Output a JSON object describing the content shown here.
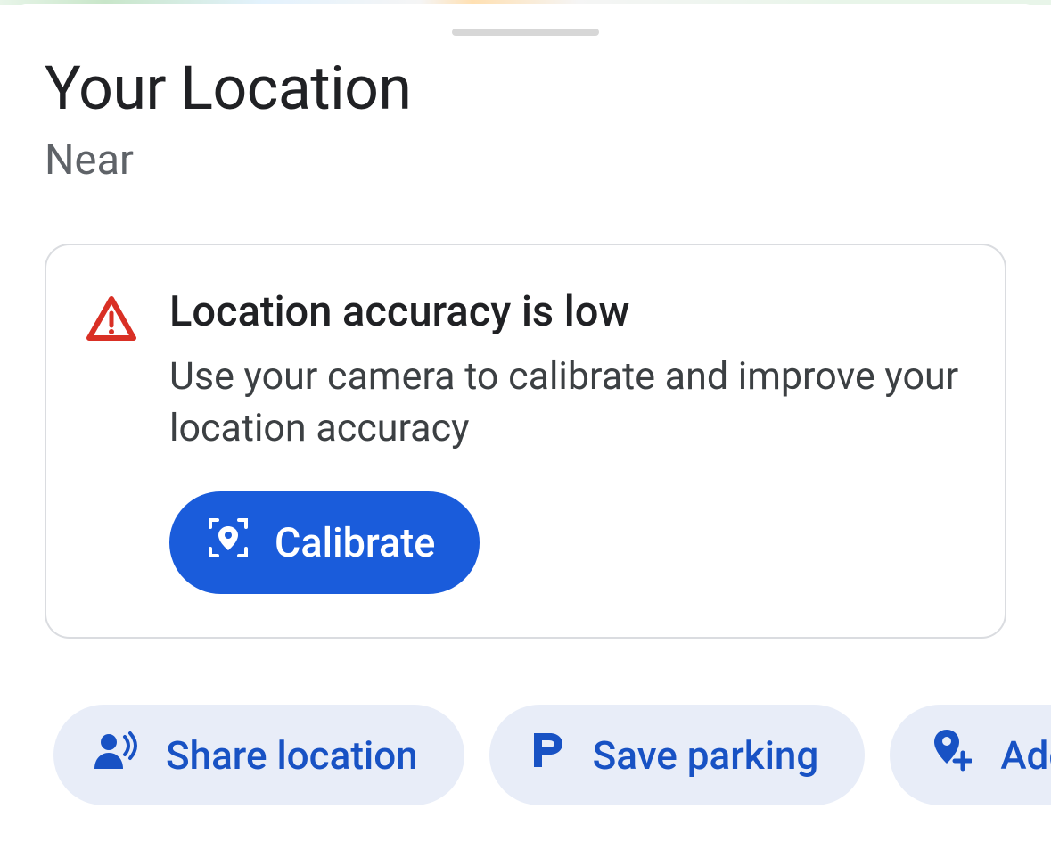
{
  "header": {
    "title": "Your Location",
    "subtitle": "Near"
  },
  "accuracy_card": {
    "title": "Location accuracy is low",
    "description": "Use your camera to calibrate and improve your location accuracy",
    "button_label": "Calibrate"
  },
  "chips": [
    {
      "label": "Share location"
    },
    {
      "label": "Save parking"
    },
    {
      "label": "Add"
    }
  ],
  "colors": {
    "accent": "#1a5cdb",
    "chip_bg": "#e8edf8",
    "chip_text": "#1852c4",
    "warning": "#d93025"
  }
}
